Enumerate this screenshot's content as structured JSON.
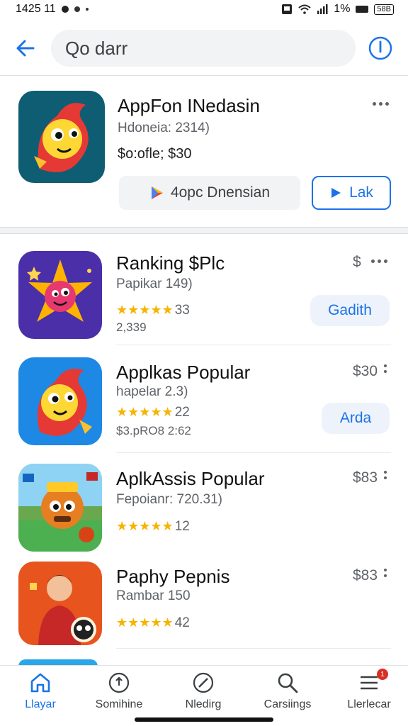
{
  "status_bar": {
    "time": "1425 11",
    "battery_percent": "1%",
    "battery_label": "58B"
  },
  "search": {
    "query": "Qo darr"
  },
  "featured": {
    "title": "AppFon INedasin",
    "subtitle": "Hdoneia: 2314)",
    "price_line": "$o:ofle; $30",
    "secondary_button": "4opc Dnensian",
    "primary_button": "Lak",
    "icon": "dragon-bird-icon",
    "icon_bg": "#0f5d73"
  },
  "list": [
    {
      "title": "Ranking $Plc",
      "subtitle": "Papikar 149)",
      "rating_stars": 4,
      "rating_text": "33",
      "extra": "2,339",
      "right_label": "$",
      "button": "Gadith",
      "icon": "star-creature-icon",
      "icon_bg": "#4a2fa8"
    },
    {
      "title": "Applkas Popular",
      "subtitle": "hapelar 2.3)",
      "rating_stars": 4,
      "rating_text": "22",
      "extra": "$3.pRO8 2:62",
      "right_label": "$30",
      "button": "Arda",
      "icon": "dragon-bird-icon",
      "icon_bg": "#1e88e5"
    },
    {
      "title": "AplkAssis Popular",
      "subtitle": "Fepoianr: 720.31)",
      "rating_stars": 4,
      "rating_text": "12",
      "extra": "",
      "right_label": "$83",
      "button": "",
      "icon": "cartoon-warrior-icon",
      "icon_bg": "#6aa84f"
    },
    {
      "title": "Paphy Pepnis",
      "subtitle": "Rambar 150",
      "rating_stars": 4,
      "rating_text": "42",
      "extra": "",
      "right_label": "$83",
      "button": "",
      "icon": "person-avatar-icon",
      "icon_bg": "#e8541e"
    }
  ],
  "bottom_nav": [
    {
      "label": "Llayar",
      "icon": "home-icon",
      "active": true
    },
    {
      "label": "Somihine",
      "icon": "add-circle-icon",
      "active": false
    },
    {
      "label": "Nledirg",
      "icon": "compass-icon",
      "active": false
    },
    {
      "label": "Carsiings",
      "icon": "search-icon",
      "active": false
    },
    {
      "label": "Llerlecar",
      "icon": "menu-icon",
      "active": false,
      "badge": "1"
    }
  ],
  "colors": {
    "accent": "#1a73e8",
    "star": "#f5b400",
    "badge": "#d93025"
  }
}
